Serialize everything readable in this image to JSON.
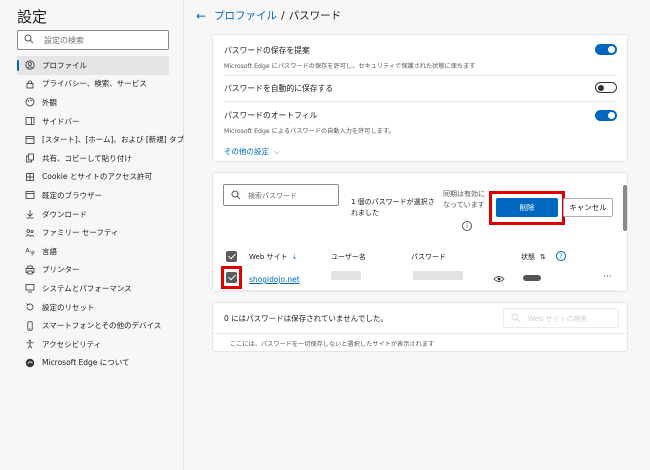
{
  "sidebar": {
    "title": "設定",
    "search_placeholder": "設定の検索",
    "items": [
      {
        "label": "プロファイル",
        "icon": "profile-icon",
        "active": true
      },
      {
        "label": "プライバシー、検索、サービス",
        "icon": "lock-icon"
      },
      {
        "label": "外観",
        "icon": "appearance-icon"
      },
      {
        "label": "サイドバー",
        "icon": "sidebar-icon"
      },
      {
        "label": "[スタート]、[ホーム]、および [新規] タブ",
        "icon": "home-icon"
      },
      {
        "label": "共有、コピーして貼り付け",
        "icon": "share-icon"
      },
      {
        "label": "Cookie とサイトのアクセス許可",
        "icon": "cookie-icon"
      },
      {
        "label": "既定のブラウザー",
        "icon": "browser-icon"
      },
      {
        "label": "ダウンロード",
        "icon": "download-icon"
      },
      {
        "label": "ファミリー セーフティ",
        "icon": "family-icon"
      },
      {
        "label": "言語",
        "icon": "language-icon"
      },
      {
        "label": "プリンター",
        "icon": "printer-icon"
      },
      {
        "label": "システムとパフォーマンス",
        "icon": "system-icon"
      },
      {
        "label": "設定のリセット",
        "icon": "reset-icon"
      },
      {
        "label": "スマートフォンとその他のデバイス",
        "icon": "phone-icon"
      },
      {
        "label": "アクセシビリティ",
        "icon": "accessibility-icon"
      },
      {
        "label": "Microsoft Edge について",
        "icon": "edge-icon"
      }
    ]
  },
  "header": {
    "back_icon": "back-arrow-icon",
    "link": "プロファイル",
    "separator": "/",
    "current": "パスワード"
  },
  "settings_card": {
    "offer_save_title": "パスワードの保存を提案",
    "offer_save_desc": "Microsoft Edge にパスワードの保存を許可し、セキュリティで保護された状態に保ちます",
    "offer_save_on": true,
    "auto_save_title": "パスワードを自動的に保存する",
    "auto_save_on": false,
    "autofill_title": "パスワードのオートフィル",
    "autofill_desc": "Microsoft Edge によるパスワードの自動入力を許可します。",
    "autofill_on": true,
    "more_settings": "その他の設定"
  },
  "passwords_card": {
    "search_placeholder": "検索パスワード",
    "selected_info": "1 個のパスワードが選択されました",
    "sync_info": "同期は有効になっています",
    "delete_button": "削除",
    "cancel_button": "キャンセル",
    "columns": {
      "website": "Web サイト",
      "username": "ユーザー名",
      "password": "パスワード",
      "status": "状態"
    },
    "rows": [
      {
        "site": "shogidojo.net",
        "checked": true
      }
    ]
  },
  "never_saved_card": {
    "title": "0 にはパスワードは保存されていませんでした。",
    "search_placeholder": "Web サイトの検索",
    "description": "ここには、パスワードを一切保存しないと選択したサイトが表示されます"
  },
  "colors": {
    "accent": "#0067c0",
    "highlight": "#e00000"
  }
}
